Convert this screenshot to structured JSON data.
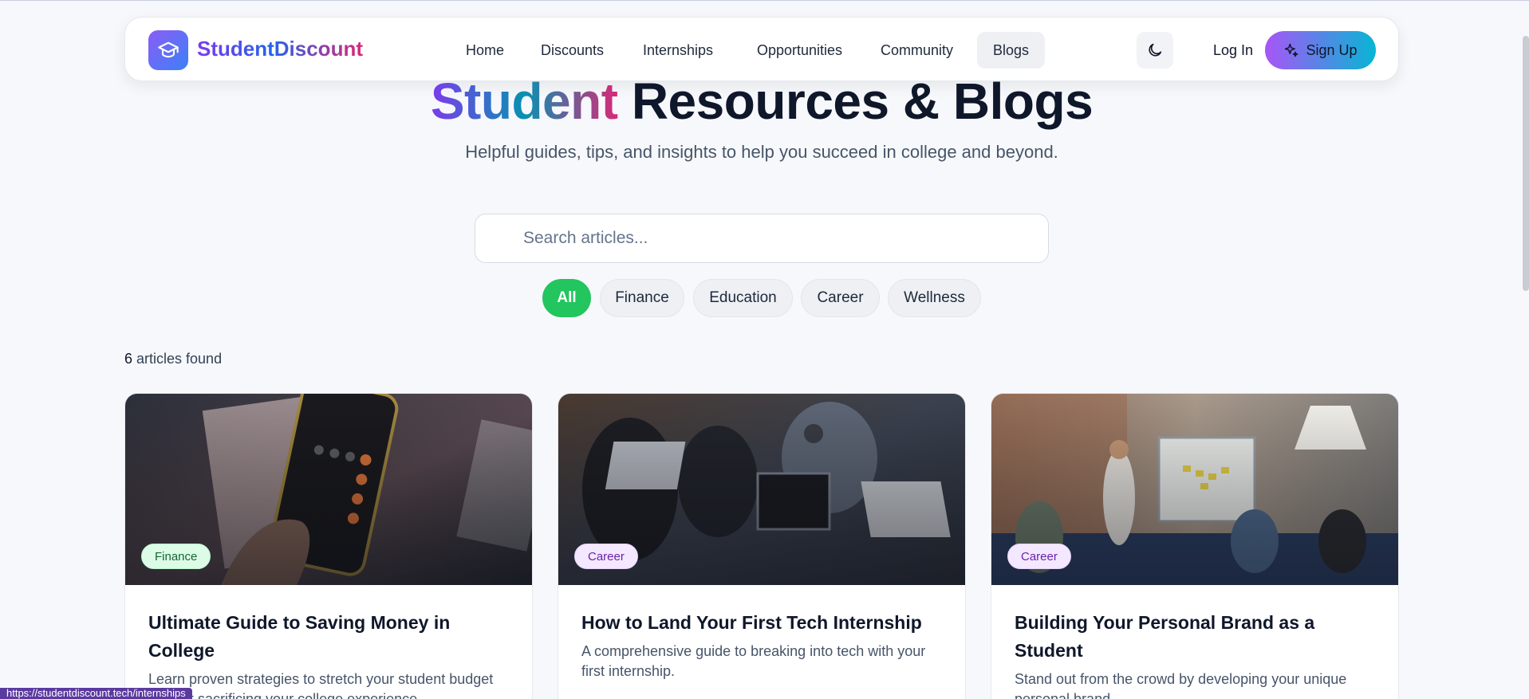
{
  "brand": {
    "name": "StudentDiscount",
    "logo_icon": "graduation-cap-icon"
  },
  "nav": {
    "items": [
      {
        "label": "Home"
      },
      {
        "label": "Discounts"
      },
      {
        "label": "Internships"
      },
      {
        "label": "Opportunities"
      },
      {
        "label": "Community"
      },
      {
        "label": "Blogs",
        "active": true
      }
    ],
    "theme_icon": "moon-icon",
    "login_label": "Log In",
    "signup_label": "Sign Up",
    "signup_icon": "sparkles-icon"
  },
  "hero": {
    "title_highlight": "Student",
    "title_rest": " Resources & Blogs",
    "subtitle": "Helpful guides, tips, and insights to help you succeed in college and beyond."
  },
  "search": {
    "placeholder": "Search articles...",
    "value": ""
  },
  "filters": {
    "items": [
      {
        "label": "All",
        "active": true
      },
      {
        "label": "Finance"
      },
      {
        "label": "Education"
      },
      {
        "label": "Career"
      },
      {
        "label": "Wellness"
      }
    ]
  },
  "results": {
    "count": "6",
    "suffix": " articles found"
  },
  "articles": [
    {
      "category": "Finance",
      "title": "Ultimate Guide to Saving Money in College",
      "description": "Learn proven strategies to stretch your student budget without sacrificing your college experience."
    },
    {
      "category": "Career",
      "title": "How to Land Your First Tech Internship",
      "description": "A comprehensive guide to breaking into tech with your first internship."
    },
    {
      "category": "Career",
      "title": "Building Your Personal Brand as a Student",
      "description": "Stand out from the crowd by developing your unique personal brand."
    }
  ],
  "status_bar": {
    "url": "https://studentdiscount.tech/internships"
  },
  "colors": {
    "accent_green": "#22c55e",
    "brand_purple": "#7c3aed",
    "signup_gradient_start": "#a855f7",
    "signup_gradient_end": "#06b6d4"
  }
}
